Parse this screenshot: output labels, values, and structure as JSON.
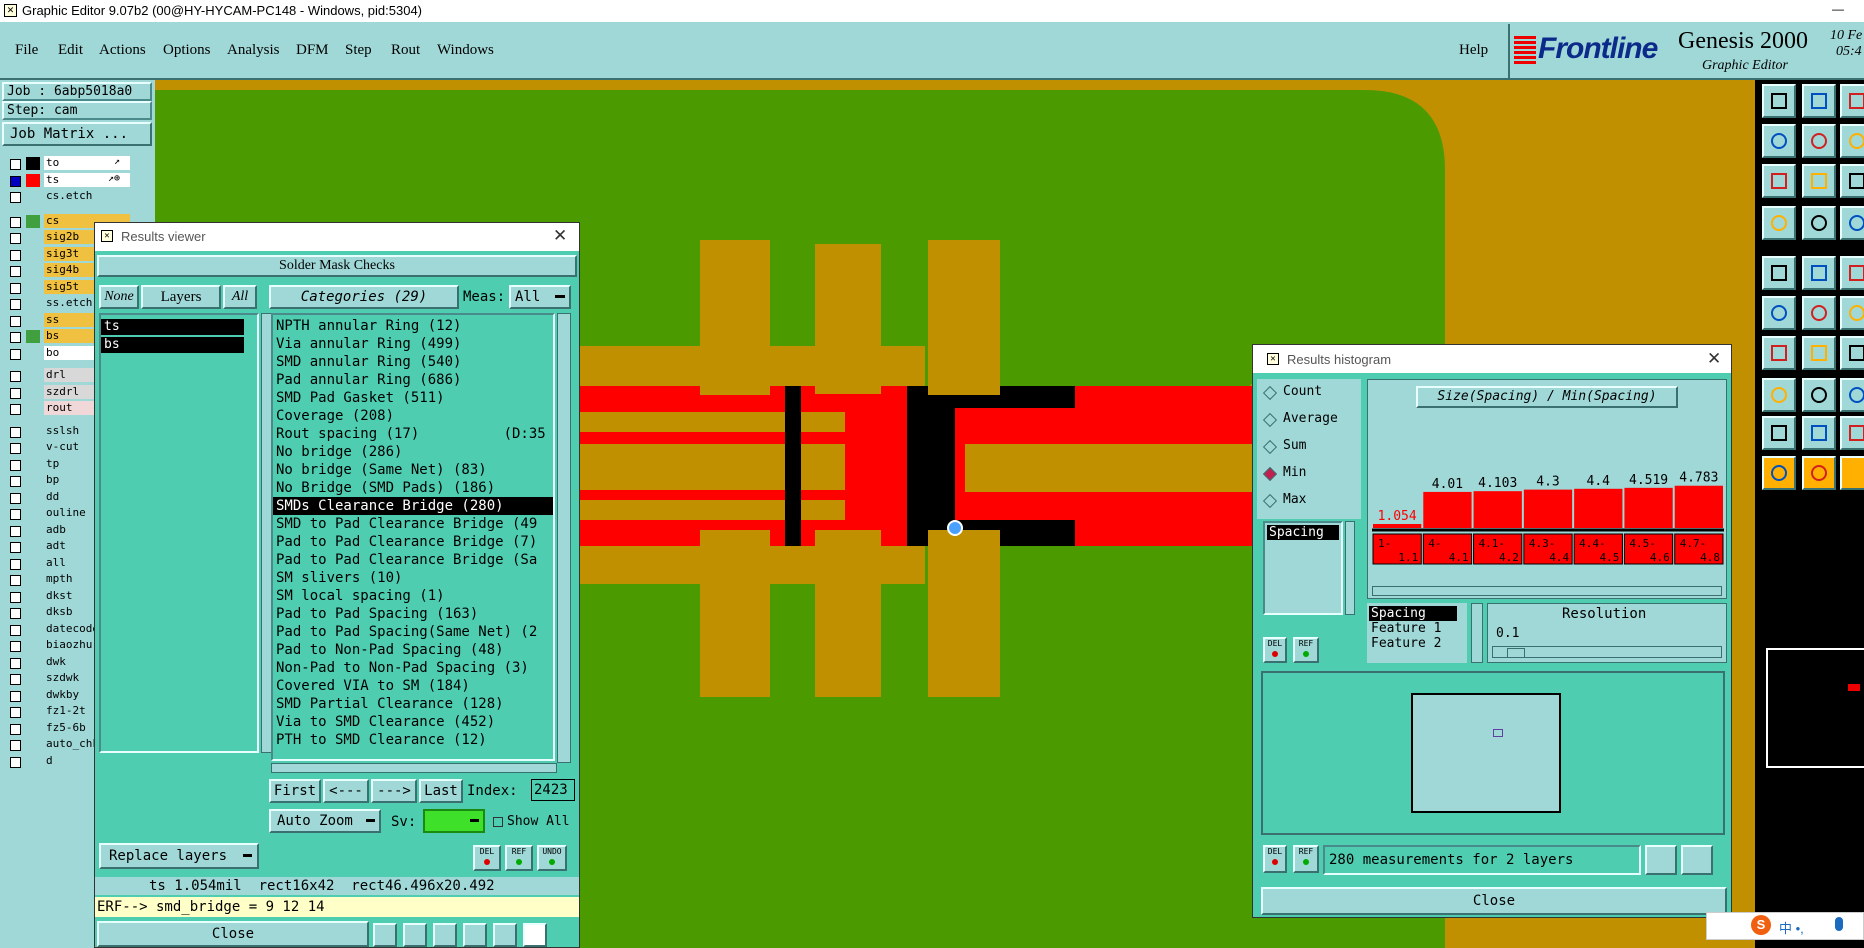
{
  "window": {
    "title": "Graphic Editor 9.07b2 (00@HY-HYCAM-PC148 - Windows, pid:5304)",
    "minimize": "—",
    "maximize": "☐"
  },
  "menubar": {
    "items": [
      "File",
      "Edit",
      "Actions",
      "Options",
      "Analysis",
      "DFM",
      "Step",
      "Rout",
      "Windows"
    ],
    "help": "Help"
  },
  "brand": {
    "logo": "Frontline",
    "product": "Genesis 2000",
    "subtitle": "Graphic Editor",
    "date": "10 Fe",
    "time": "05:4"
  },
  "left_panel": {
    "job": "Job : 6abp5018a0",
    "step": "Step: cam",
    "job_matrix": "Job Matrix ...",
    "layers": [
      {
        "name": "to",
        "color": "#ffffff",
        "swatch": "#000000",
        "suffix": "↗"
      },
      {
        "name": "ts",
        "color": "#ffffff",
        "swatch": "#ff0000",
        "suffix": "↗⊕",
        "active": true
      },
      {
        "name": "cs.etch",
        "color": "#a0d8d8",
        "swatch": "#a0d8d8"
      },
      {
        "name": "cs",
        "color": "#f0c040",
        "swatch": "#40a040"
      },
      {
        "name": "sig2b",
        "color": "#f0c040",
        "swatch": "#a0d8d8"
      },
      {
        "name": "sig3t",
        "color": "#f0c040",
        "swatch": "#a0d8d8"
      },
      {
        "name": "sig4b",
        "color": "#f0c040",
        "swatch": "#a0d8d8"
      },
      {
        "name": "sig5t",
        "color": "#f0c040",
        "swatch": "#a0d8d8"
      },
      {
        "name": "ss.etch",
        "color": "#a0d8d8",
        "swatch": "#a0d8d8"
      },
      {
        "name": "ss",
        "color": "#f0c040",
        "swatch": "#a0d8d8"
      },
      {
        "name": "bs",
        "color": "#f0c040",
        "swatch": "#40a040"
      },
      {
        "name": "bo",
        "color": "#ffffff",
        "swatch": "#a0d8d8"
      },
      {
        "name": "drl",
        "color": "#d8d8d8",
        "swatch": "#a0d8d8"
      },
      {
        "name": "szdrl",
        "color": "#d8d8d8",
        "swatch": "#a0d8d8"
      },
      {
        "name": "rout",
        "color": "#f0d8d8",
        "swatch": "#a0d8d8"
      },
      {
        "name": "sslsh",
        "color": "#a0d8d8",
        "swatch": "#a0d8d8"
      },
      {
        "name": "v-cut",
        "color": "#a0d8d8",
        "swatch": "#a0d8d8"
      },
      {
        "name": "tp",
        "color": "#a0d8d8",
        "swatch": "#a0d8d8"
      },
      {
        "name": "bp",
        "color": "#a0d8d8",
        "swatch": "#a0d8d8"
      },
      {
        "name": "dd",
        "color": "#a0d8d8",
        "swatch": "#a0d8d8"
      },
      {
        "name": "ouline",
        "color": "#a0d8d8",
        "swatch": "#a0d8d8"
      },
      {
        "name": "adb",
        "color": "#a0d8d8",
        "swatch": "#a0d8d8"
      },
      {
        "name": "adt",
        "color": "#a0d8d8",
        "swatch": "#a0d8d8"
      },
      {
        "name": "all",
        "color": "#a0d8d8",
        "swatch": "#a0d8d8"
      },
      {
        "name": "mpth",
        "color": "#a0d8d8",
        "swatch": "#a0d8d8"
      },
      {
        "name": "dkst",
        "color": "#a0d8d8",
        "swatch": "#a0d8d8"
      },
      {
        "name": "dksb",
        "color": "#a0d8d8",
        "swatch": "#a0d8d8"
      },
      {
        "name": "datecode",
        "color": "#a0d8d8",
        "swatch": "#a0d8d8"
      },
      {
        "name": "biaozhu",
        "color": "#a0d8d8",
        "swatch": "#a0d8d8"
      },
      {
        "name": "dwk",
        "color": "#a0d8d8",
        "swatch": "#a0d8d8"
      },
      {
        "name": "szdwk",
        "color": "#a0d8d8",
        "swatch": "#a0d8d8"
      },
      {
        "name": "dwkby",
        "color": "#a0d8d8",
        "swatch": "#a0d8d8"
      },
      {
        "name": "fz1-2t",
        "color": "#a0d8d8",
        "swatch": "#a0d8d8"
      },
      {
        "name": "fz5-6b",
        "color": "#a0d8d8",
        "swatch": "#a0d8d8"
      },
      {
        "name": "auto_chk",
        "color": "#a0d8d8",
        "swatch": "#a0d8d8"
      },
      {
        "name": "d",
        "color": "#a0d8d8",
        "swatch": "#a0d8d8"
      }
    ]
  },
  "results_viewer": {
    "title": "Results viewer",
    "header": "Solder Mask Checks",
    "none_btn": "None",
    "layers_btn": "Layers",
    "all_btn": "All",
    "categories_btn": "Categories (29)",
    "meas_label": "Meas:",
    "meas_value": "All",
    "layer_list": [
      "ts",
      "bs"
    ],
    "categories": [
      "NPTH annular Ring (12)",
      "Via annular Ring (499)",
      "SMD annular Ring (540)",
      "Pad annular Ring (686)",
      "SMD Pad Gasket (511)",
      "Coverage (208)",
      "Rout spacing (17)          (D:35",
      "No bridge (286)",
      "No bridge (Same Net) (83)",
      "No Bridge (SMD Pads) (186)",
      "SMDs Clearance Bridge (280)",
      "SMD to Pad Clearance Bridge (49",
      "Pad to Pad Clearance Bridge (7)",
      "Pad to Pad Clearance Bridge (Sa",
      "SM slivers (10)",
      "SM local spacing (1)",
      "Pad to Pad Spacing (163)",
      "Pad to Pad Spacing(Same Net) (2",
      "Pad to Non-Pad Spacing (48)",
      "Non-Pad to Non-Pad Spacing (3)",
      "Covered VIA to SM (184)",
      "SMD Partial Clearance (128)",
      "Via to SMD Clearance (452)",
      "PTH to SMD Clearance (12)"
    ],
    "selected_index": 10,
    "nav": {
      "first": "First",
      "prev": "<---",
      "next": "--->",
      "last": "Last",
      "index_label": "Index:",
      "index_value": "2423"
    },
    "auto_zoom": "Auto Zoom",
    "sv_label": "Sv:",
    "show_all": "Show All",
    "replace_layers": "Replace layers",
    "del": "DEL",
    "ref": "REF",
    "undo": "UNDO",
    "status": "ts 1.054mil  rect16x42  rect46.496x20.492",
    "erf": "ERF--> smd_bridge = 9 12 14",
    "close": "Close"
  },
  "histogram": {
    "title": "Results histogram",
    "options": [
      "Count",
      "Average",
      "Sum",
      "Min",
      "Max"
    ],
    "selected_option": "Min",
    "measure_list": [
      "Spacing"
    ],
    "chart_title": "Size(Spacing) / Min(Spacing)",
    "del": "DEL",
    "ref": "REF",
    "fields": [
      "Spacing",
      "Feature 1",
      "Feature 2"
    ],
    "resolution_label": "Resolution",
    "resolution_value": "0.1",
    "summary": "280 measurements for 2 layers",
    "close": "Close"
  },
  "chart_data": {
    "type": "bar",
    "title": "Size(Spacing) / Min(Spacing)",
    "categories": [
      "1-1.1",
      "4-4.1",
      "4.1-4.2",
      "4.3-4.4",
      "4.4-4.5",
      "4.5-4.6",
      "4.7-4.8"
    ],
    "values": [
      1.054,
      4.01,
      4.103,
      4.3,
      4.4,
      4.519,
      4.783
    ],
    "value_labels": [
      "1.054",
      "4.01",
      "4.103",
      "4.3",
      "4.4",
      "4.519",
      "4.783"
    ],
    "ylim": [
      0,
      5
    ],
    "colors": {
      "bar": "#ff0000",
      "first_label": "#ff0000"
    }
  },
  "colors": {
    "accent": "#4fcdb0",
    "panel": "#a0d8d8",
    "copper": "#c09000",
    "soldermask": "#ff0000",
    "board": "#4a9a00"
  }
}
